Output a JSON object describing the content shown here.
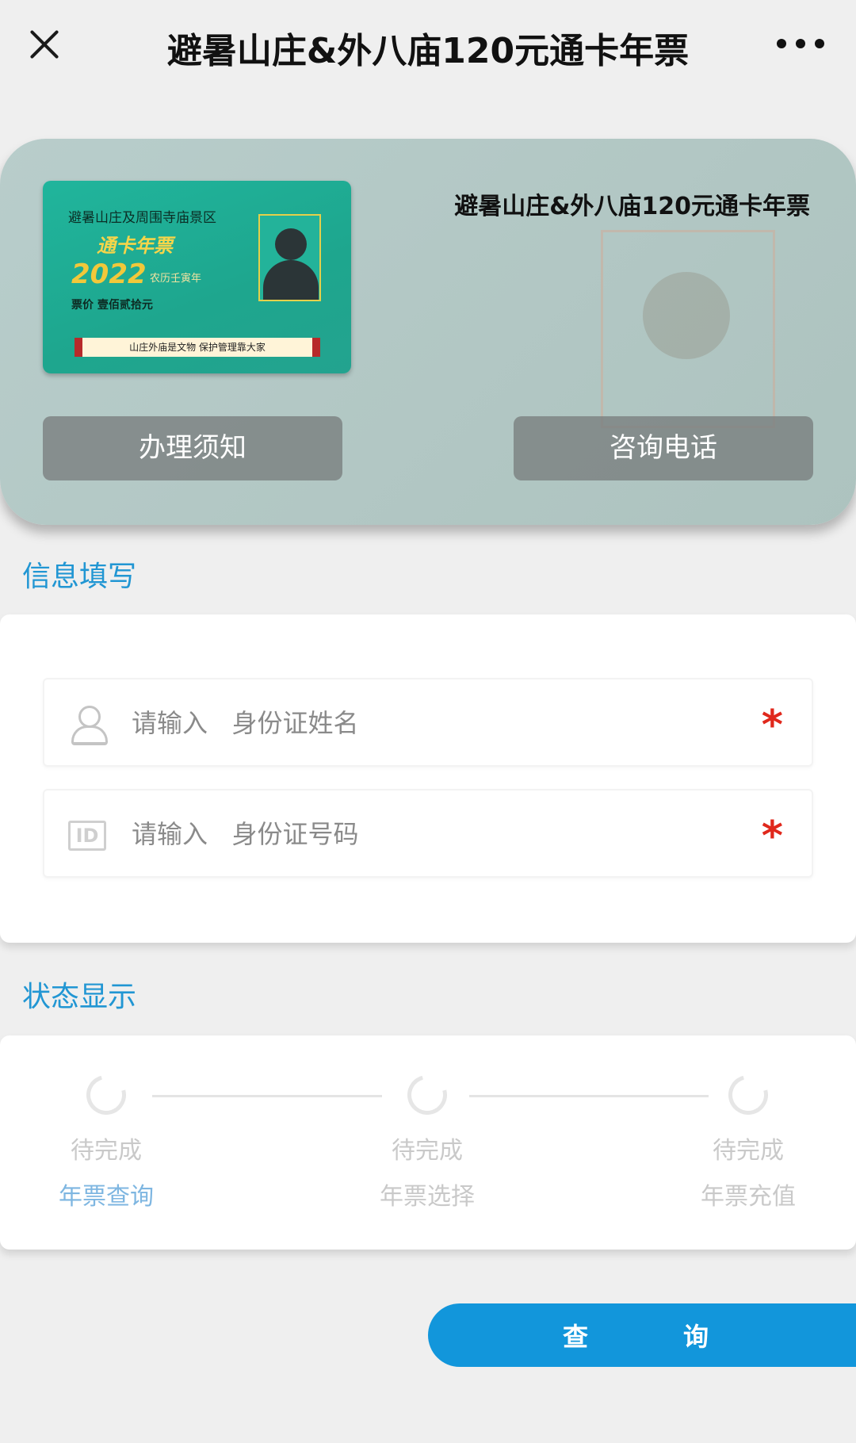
{
  "navbar": {
    "title": "避暑山庄&外八庙120元通卡年票",
    "close_icon": "close-icon",
    "more_icon": "more-dots-icon"
  },
  "hero": {
    "title": "避暑山庄&外八庙120元通卡年票",
    "card": {
      "org": "避暑山庄及周围寺庙景区",
      "name": "通卡年票",
      "year": "2022",
      "lunar": "农历壬寅年",
      "price": "票价 壹佰贰拾元",
      "slogan": "山庄外庙是文物  保护管理靠大家"
    },
    "notice_button": "办理须知",
    "phone_button": "咨询电话"
  },
  "form": {
    "section_title": "信息填写",
    "name_placeholder": "请输入   身份证姓名",
    "id_placeholder": "请输入   身份证号码",
    "required_mark": "*",
    "id_icon_text": "ID"
  },
  "status": {
    "section_title": "状态显示",
    "steps": [
      {
        "state": "待完成",
        "label": "年票查询",
        "active": true
      },
      {
        "state": "待完成",
        "label": "年票选择",
        "active": false
      },
      {
        "state": "待完成",
        "label": "年票充值",
        "active": false
      }
    ]
  },
  "query_button": "查询",
  "colors": {
    "accent": "#1296db",
    "section_title": "#2196d3",
    "required": "#e0281c",
    "card_green": "#20b59c"
  }
}
